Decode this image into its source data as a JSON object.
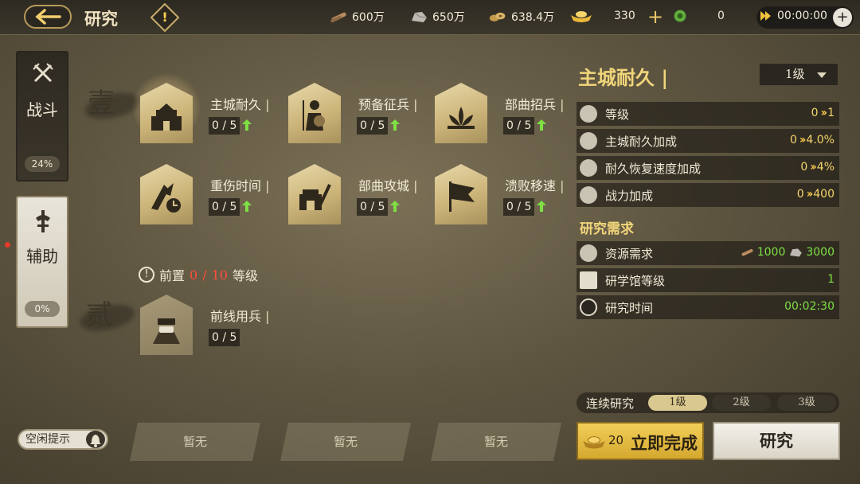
{
  "header": {
    "title": "研究",
    "resources": [
      {
        "icon": "wood-icon",
        "value": "600万"
      },
      {
        "icon": "stone-icon",
        "value": "650万"
      },
      {
        "icon": "copper-coins-icon",
        "value": "638.4万"
      },
      {
        "icon": "gold-ingot-icon",
        "value": "330"
      },
      {
        "icon": "jade-icon",
        "value": "0"
      }
    ],
    "speedup_time": "00:00:00",
    "add_symbol": "+"
  },
  "side_tabs": [
    {
      "label": "战斗",
      "progress": "24%",
      "icon": "crossed-swords-icon"
    },
    {
      "label": "辅助",
      "progress": "0%",
      "icon": "helmet-icon"
    }
  ],
  "tiers": [
    "壹",
    "贰"
  ],
  "nodes": [
    {
      "name": "主城耐久",
      "level": "0 / 5",
      "icon": "city-wall-icon"
    },
    {
      "name": "预备征兵",
      "level": "0 / 5",
      "icon": "soldier-icon"
    },
    {
      "name": "部曲招兵",
      "level": "0 / 5",
      "icon": "lotus-icon"
    },
    {
      "name": "重伤时间",
      "level": "0 / 5",
      "icon": "wounded-clock-icon"
    },
    {
      "name": "部曲攻城",
      "level": "0 / 5",
      "icon": "siege-icon"
    },
    {
      "name": "溃败移速",
      "level": "0 / 5",
      "icon": "flag-icon"
    },
    {
      "name": "前线用兵",
      "level": "0 / 5",
      "icon": "frontline-icon"
    }
  ],
  "prereq": {
    "prefix": "前置",
    "current": "0",
    "sep": "/",
    "required": "10",
    "suffix": "等级",
    "mark": "!"
  },
  "detail": {
    "title": "主城耐久",
    "level_select": "1级",
    "stats": [
      {
        "name": "等级",
        "from": "0",
        "to": "1",
        "icon": "level-icon"
      },
      {
        "name": "主城耐久加成",
        "from": "0",
        "to": "4.0%",
        "icon": "diamond-icon"
      },
      {
        "name": "耐久恢复速度加成",
        "from": "0",
        "to": "4%",
        "icon": "diamond-icon"
      },
      {
        "name": "战力加成",
        "from": "0",
        "to": "400",
        "icon": "power-icon"
      }
    ],
    "requirements_title": "研究需求",
    "requirements": {
      "resource": {
        "name": "资源需求",
        "wood": "1000",
        "stone": "3000"
      },
      "academy": {
        "name": "研学馆等级",
        "value": "1"
      },
      "time": {
        "name": "研究时间",
        "value": "00:02:30"
      }
    }
  },
  "continuous": {
    "label": "连续研究",
    "options": [
      "1级",
      "2级",
      "3级"
    ],
    "selected": "1级"
  },
  "buttons": {
    "complete_cost": "20",
    "complete_label": "立即完成",
    "research_label": "研究"
  },
  "idle_tip": "空闲提示",
  "queue_slots": [
    "暂无",
    "暂无",
    "暂无"
  ],
  "colors": {
    "accent_gold": "#f0d57a",
    "green": "#7ee043",
    "red": "#ff4d3a"
  }
}
